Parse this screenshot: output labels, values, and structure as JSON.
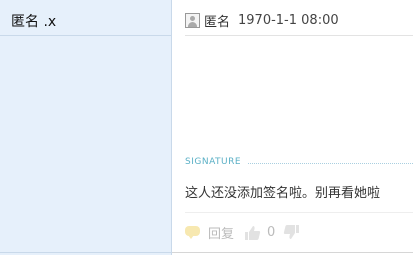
{
  "author": {
    "name": "匿名 .x"
  },
  "post": {
    "author_name": "匿名",
    "timestamp": "1970-1-1 08:00"
  },
  "signature": {
    "label": "SIGNATURE",
    "text": "这人还没添加签名啦。别再看她啦"
  },
  "actions": {
    "reply_label": "回复",
    "like_count": "0"
  },
  "icons": {
    "avatar": "avatar-placeholder-icon",
    "reply": "chat-bubble-icon",
    "like": "thumbs-up-icon",
    "dislike": "thumbs-down-icon"
  }
}
